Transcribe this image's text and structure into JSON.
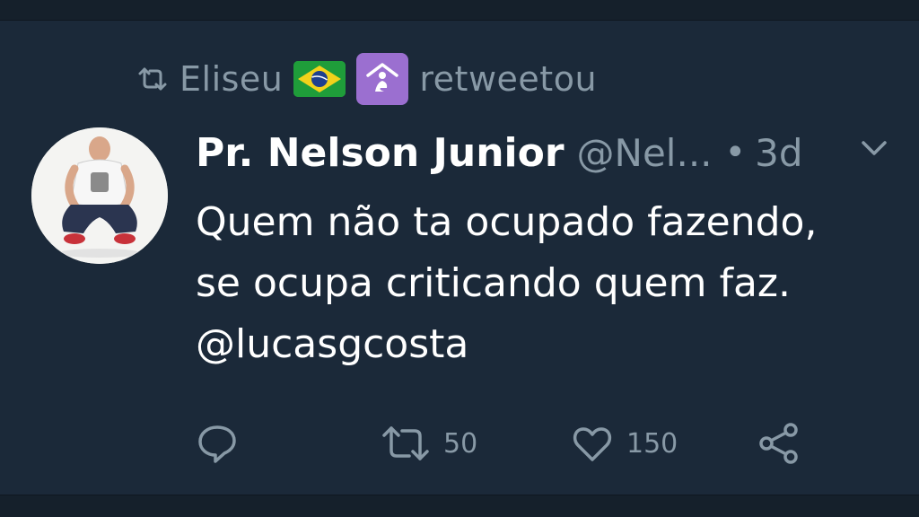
{
  "retweet_bar": {
    "retweeter_name": "Eliseu",
    "verb": "retweetou",
    "emojis": [
      "flag-brazil",
      "person-kneeling-praying-house"
    ]
  },
  "tweet": {
    "author_name": "Pr. Nelson Junior",
    "author_handle": "@Nel...",
    "separator": "•",
    "time": "3d",
    "text_lines": [
      "Quem não ta ocupado fazendo,",
      "se ocupa criticando quem faz.",
      "@lucasgcosta"
    ]
  },
  "actions": {
    "reply_count": "",
    "retweet_count": "50",
    "like_count": "150"
  },
  "colors": {
    "background": "#1b2939",
    "primary_text": "#ffffff",
    "secondary_text": "#8899a6"
  },
  "icons": [
    "retweet-icon",
    "chevron-down-icon",
    "reply-icon",
    "like-icon",
    "share-icon"
  ]
}
